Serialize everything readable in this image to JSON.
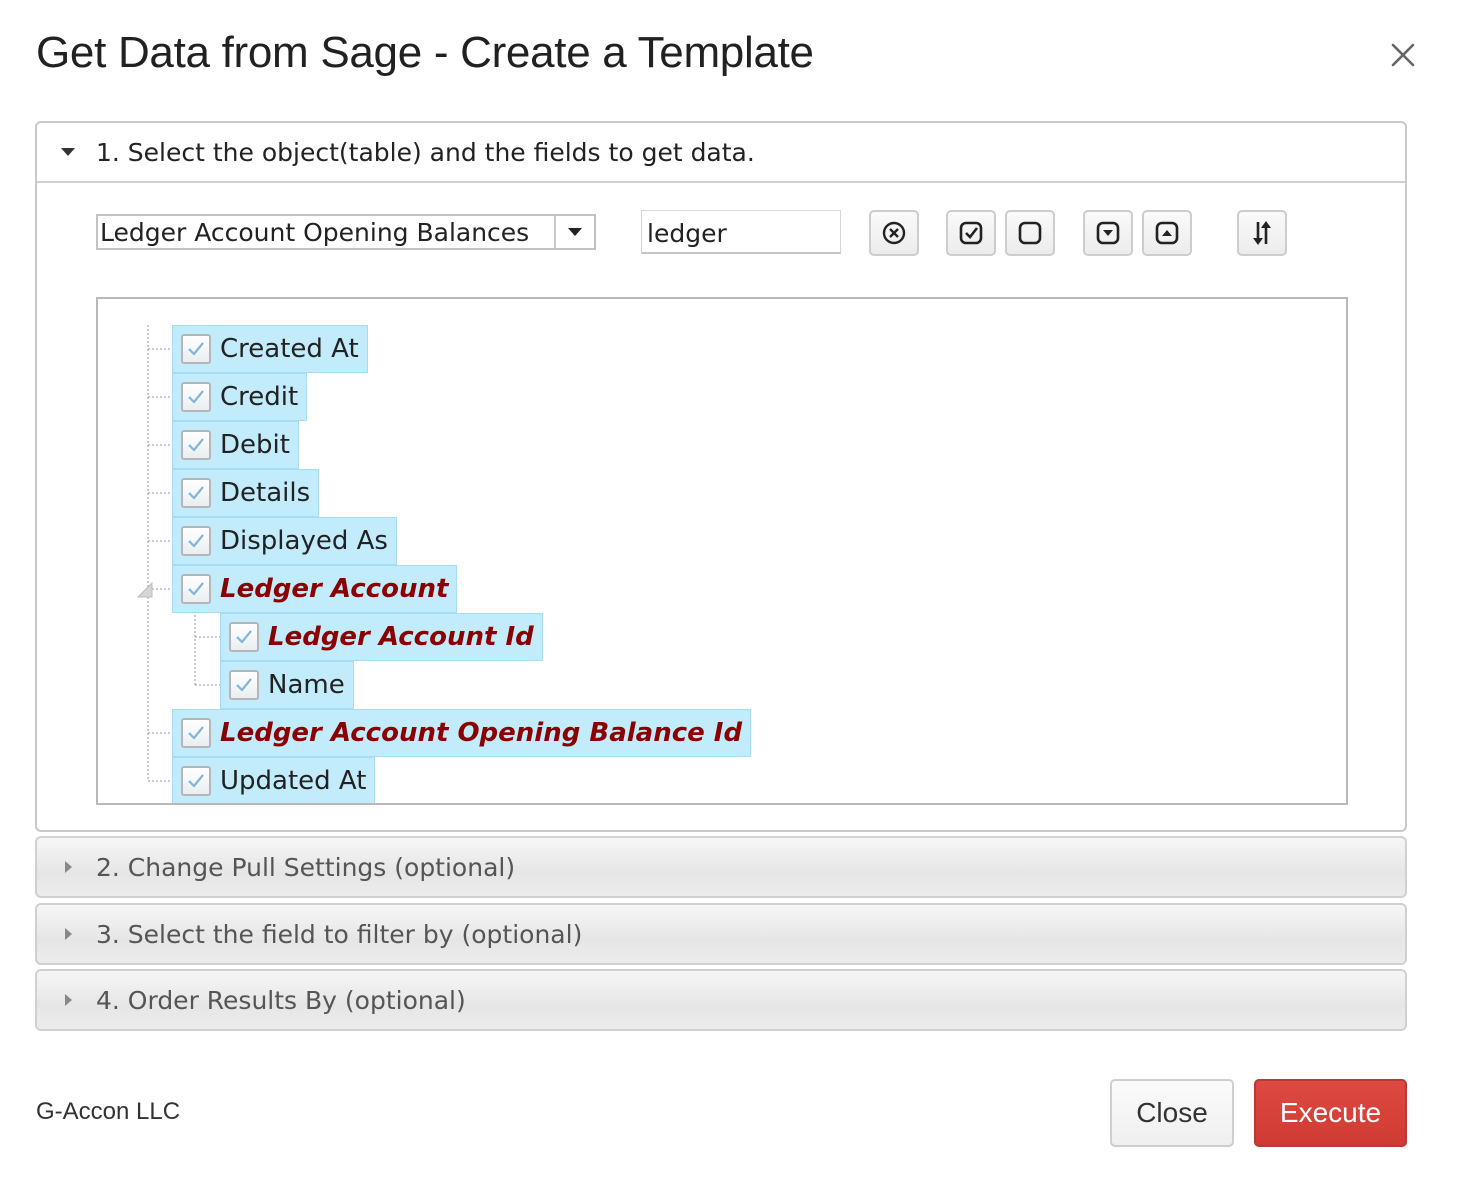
{
  "dialog": {
    "title": "Get Data from Sage - Create a Template",
    "close_icon": "close-icon"
  },
  "section1": {
    "header": "1. Select the object(table) and the fields to get data.",
    "object_select": {
      "value": "Ledger Account Opening Balances"
    },
    "search": {
      "value": "ledger"
    },
    "toolbar": [
      {
        "name": "clear-search-button",
        "icon": "circle-x-icon"
      },
      {
        "name": "select-all-button",
        "icon": "check-square-icon"
      },
      {
        "name": "deselect-all-button",
        "icon": "empty-square-icon"
      },
      {
        "name": "expand-all-button",
        "icon": "chevron-down-square-icon"
      },
      {
        "name": "collapse-all-button",
        "icon": "chevron-up-square-icon"
      },
      {
        "name": "sort-button",
        "icon": "sort-arrows-icon"
      }
    ],
    "tree": [
      {
        "label": "Created At",
        "checked": true,
        "key": false,
        "level": 0
      },
      {
        "label": "Credit",
        "checked": true,
        "key": false,
        "level": 0
      },
      {
        "label": "Debit",
        "checked": true,
        "key": false,
        "level": 0
      },
      {
        "label": "Details",
        "checked": true,
        "key": false,
        "level": 0
      },
      {
        "label": "Displayed As",
        "checked": true,
        "key": false,
        "level": 0
      },
      {
        "label": "Ledger Account",
        "checked": true,
        "key": true,
        "level": 0,
        "expanded": true
      },
      {
        "label": "Ledger Account Id",
        "checked": true,
        "key": true,
        "level": 1
      },
      {
        "label": "Name",
        "checked": true,
        "key": false,
        "level": 1
      },
      {
        "label": "Ledger Account Opening Balance Id",
        "checked": true,
        "key": true,
        "level": 0
      },
      {
        "label": "Updated At",
        "checked": true,
        "key": false,
        "level": 0
      }
    ]
  },
  "sections": [
    {
      "label": "2. Change Pull Settings (optional)"
    },
    {
      "label": "3. Select the field to filter by (optional)"
    },
    {
      "label": "4. Order Results By (optional)"
    }
  ],
  "footer": {
    "brand": "G-Accon LLC",
    "close_label": "Close",
    "execute_label": "Execute"
  },
  "colors": {
    "accent_red": "#d2403a",
    "selected_node_bg": "#c2ebfc",
    "key_field_text": "#8b0000"
  }
}
